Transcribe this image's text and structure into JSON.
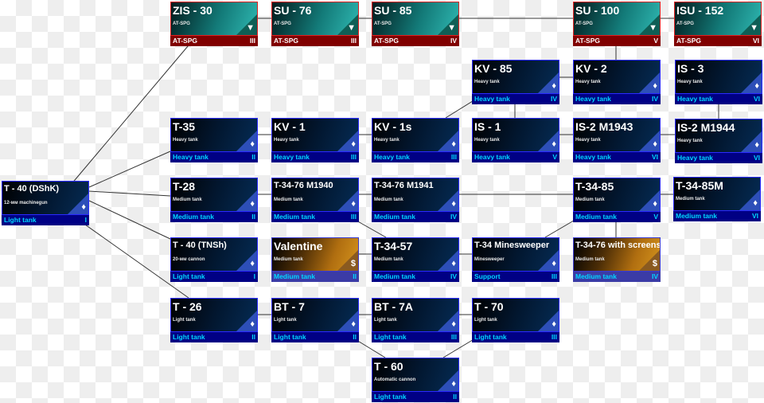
{
  "colors": {
    "light_border": "#2a2aff",
    "spg_border": "#e02020",
    "footer_blue": "#000084",
    "footer_text": "#00d8ff",
    "spg_footer": "#800000"
  },
  "cards": [
    {
      "name": "ZIS - 30",
      "sub": "AT-SPG",
      "type": "AT-SPG",
      "tier": "III",
      "style": "spg",
      "icon": "at-spg-icon"
    },
    {
      "name": "SU - 76",
      "sub": "AT-SPG",
      "type": "AT-SPG",
      "tier": "III",
      "style": "spg",
      "icon": "at-spg-icon"
    },
    {
      "name": "SU - 85",
      "sub": "AT-SPG",
      "type": "AT-SPG",
      "tier": "IV",
      "style": "spg",
      "icon": "at-spg-icon"
    },
    {
      "name": "SU - 100",
      "sub": "AT-SPG",
      "type": "AT-SPG",
      "tier": "V",
      "style": "spg",
      "icon": "at-spg-icon"
    },
    {
      "name": "ISU - 152",
      "sub": "AT-SPG",
      "type": "AT-SPG",
      "tier": "VI",
      "style": "spg",
      "icon": "at-spg-icon"
    },
    {
      "name": "KV - 85",
      "sub": "Heavy tank",
      "type": "Heavy tank",
      "tier": "IV",
      "style": "std",
      "icon": "diamond-icon"
    },
    {
      "name": "KV - 2",
      "sub": "Heavy tank",
      "type": "Heavy tank",
      "tier": "IV",
      "style": "std",
      "icon": "diamond-icon"
    },
    {
      "name": "IS - 3",
      "sub": "Heavy tank",
      "type": "Heavy tank",
      "tier": "VI",
      "style": "std",
      "icon": "diamond-icon"
    },
    {
      "name": "T-35",
      "sub": "Heavy tank",
      "type": "Heavy tank",
      "tier": "II",
      "style": "std",
      "icon": "diamond-icon"
    },
    {
      "name": "KV - 1",
      "sub": "Heavy tank",
      "type": "Heavy tank",
      "tier": "III",
      "style": "std",
      "icon": "diamond-icon"
    },
    {
      "name": "KV - 1s",
      "sub": "Heavy tank",
      "type": "Heavy tank",
      "tier": "III",
      "style": "std",
      "icon": "diamond-icon"
    },
    {
      "name": "IS - 1",
      "sub": "Heavy tank",
      "type": "Heavy tank",
      "tier": "V",
      "style": "std",
      "icon": "diamond-icon"
    },
    {
      "name": "IS-2 M1943",
      "sub": "Heavy tank",
      "type": "Heavy tank",
      "tier": "VI",
      "style": "std",
      "icon": "diamond-icon"
    },
    {
      "name": "IS-2 M1944",
      "sub": "Heavy tank",
      "type": "Heavy tank",
      "tier": "VI",
      "style": "std",
      "icon": "diamond-icon"
    },
    {
      "name": "T - 40 (DShK)",
      "sub": "12-мм machinegun",
      "type": "Light tank",
      "tier": "I",
      "style": "std",
      "icon": "diamond-icon"
    },
    {
      "name": "T-28",
      "sub": "Medium tank",
      "type": "Medium tank",
      "tier": "II",
      "style": "std",
      "icon": "diamond-icon"
    },
    {
      "name": "T-34-76 M1940",
      "sub": "Medium tank",
      "type": "Medium tank",
      "tier": "III",
      "style": "std",
      "icon": "diamond-icon"
    },
    {
      "name": "T-34-76 M1941",
      "sub": "Medium tank",
      "type": "Medium tank",
      "tier": "IV",
      "style": "std",
      "icon": "diamond-icon"
    },
    {
      "name": "T-34-85",
      "sub": "Medium tank",
      "type": "Medium tank",
      "tier": "V",
      "style": "std",
      "icon": "diamond-icon"
    },
    {
      "name": "T-34-85M",
      "sub": "Medium tank",
      "type": "Medium tank",
      "tier": "VI",
      "style": "std",
      "icon": "diamond-icon"
    },
    {
      "name": "T - 40 (TNSh)",
      "sub": "20-мм cannon",
      "type": "Light tank",
      "tier": "I",
      "style": "std",
      "icon": "diamond-icon"
    },
    {
      "name": "Valentine",
      "sub": "Medium tank",
      "type": "Medium tank",
      "tier": "II",
      "style": "prem",
      "icon": "dollar-icon"
    },
    {
      "name": "T-34-57",
      "sub": "Medium tank",
      "type": "Medium tank",
      "tier": "IV",
      "style": "std",
      "icon": "diamond-icon"
    },
    {
      "name": "T-34 Minesweeper",
      "sub": "Minesweeper",
      "type": "Support",
      "tier": "III",
      "style": "std",
      "icon": "diamond-icon"
    },
    {
      "name": "T-34-76 with screens",
      "sub": "Medium tank",
      "type": "Medium tank",
      "tier": "IV",
      "style": "prem",
      "icon": "dollar-icon"
    },
    {
      "name": "T - 26",
      "sub": "Light tank",
      "type": "Light tank",
      "tier": "II",
      "style": "std",
      "icon": "diamond-icon"
    },
    {
      "name": "BT - 7",
      "sub": "Light tank",
      "type": "Light tank",
      "tier": "II",
      "style": "std",
      "icon": "diamond-icon"
    },
    {
      "name": "BT - 7A",
      "sub": "Light tank",
      "type": "Light tank",
      "tier": "III",
      "style": "std",
      "icon": "diamond-icon"
    },
    {
      "name": "T - 70",
      "sub": "Light tank",
      "type": "Light tank",
      "tier": "III",
      "style": "std",
      "icon": "diamond-icon"
    },
    {
      "name": "T - 60",
      "sub": "Automatic cannon",
      "type": "Light tank",
      "tier": "II",
      "style": "std",
      "icon": "diamond-icon"
    }
  ]
}
